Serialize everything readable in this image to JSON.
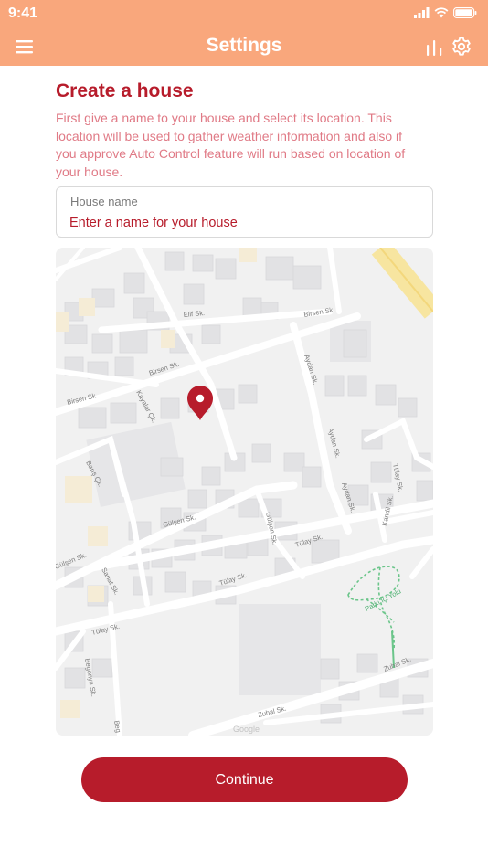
{
  "status_bar": {
    "time": "9:41"
  },
  "app_bar": {
    "title": "Settings"
  },
  "icons": {
    "menu": "menu-icon",
    "chart": "bar-chart-icon",
    "settings": "gear-icon",
    "location": "map-pin-icon",
    "signal": "signal-icon",
    "wifi": "wifi-icon",
    "battery": "battery-icon"
  },
  "form": {
    "heading": "Create a house",
    "description": "First give a name to your house and select its location. This location will be used to gather weather information and also if you approve Auto Control feature will run based on location of your house.",
    "house_name": {
      "label": "House name",
      "placeholder": "Enter a name for your house",
      "value": ""
    }
  },
  "map": {
    "streets": [
      "Elif Sk.",
      "Birsen Sk.",
      "Birsen Sk.",
      "Birsen Sk.",
      "Kayalar Çk.",
      "Aydan Sk.",
      "Aydan Sk.",
      "Aydan Sk.",
      "Barış Çk.",
      "Gülşen Sk.",
      "Gülşen Sk.",
      "Tülay Sk.",
      "Tülay Sk.",
      "Tülay Sk.",
      "Tülay Sk.",
      "Kandil Sk.",
      "Parkı İçi Yolu",
      "Gülşen Sk.",
      "Sanat Sk.",
      "Begonya Sk.",
      "Zuhal Sk.",
      "Zuhal Sk.",
      "Beg"
    ],
    "attribution": "Google"
  },
  "actions": {
    "continue_label": "Continue"
  },
  "colors": {
    "header": "#f9a77c",
    "accent": "#b71c2b",
    "description": "#e07a86"
  }
}
